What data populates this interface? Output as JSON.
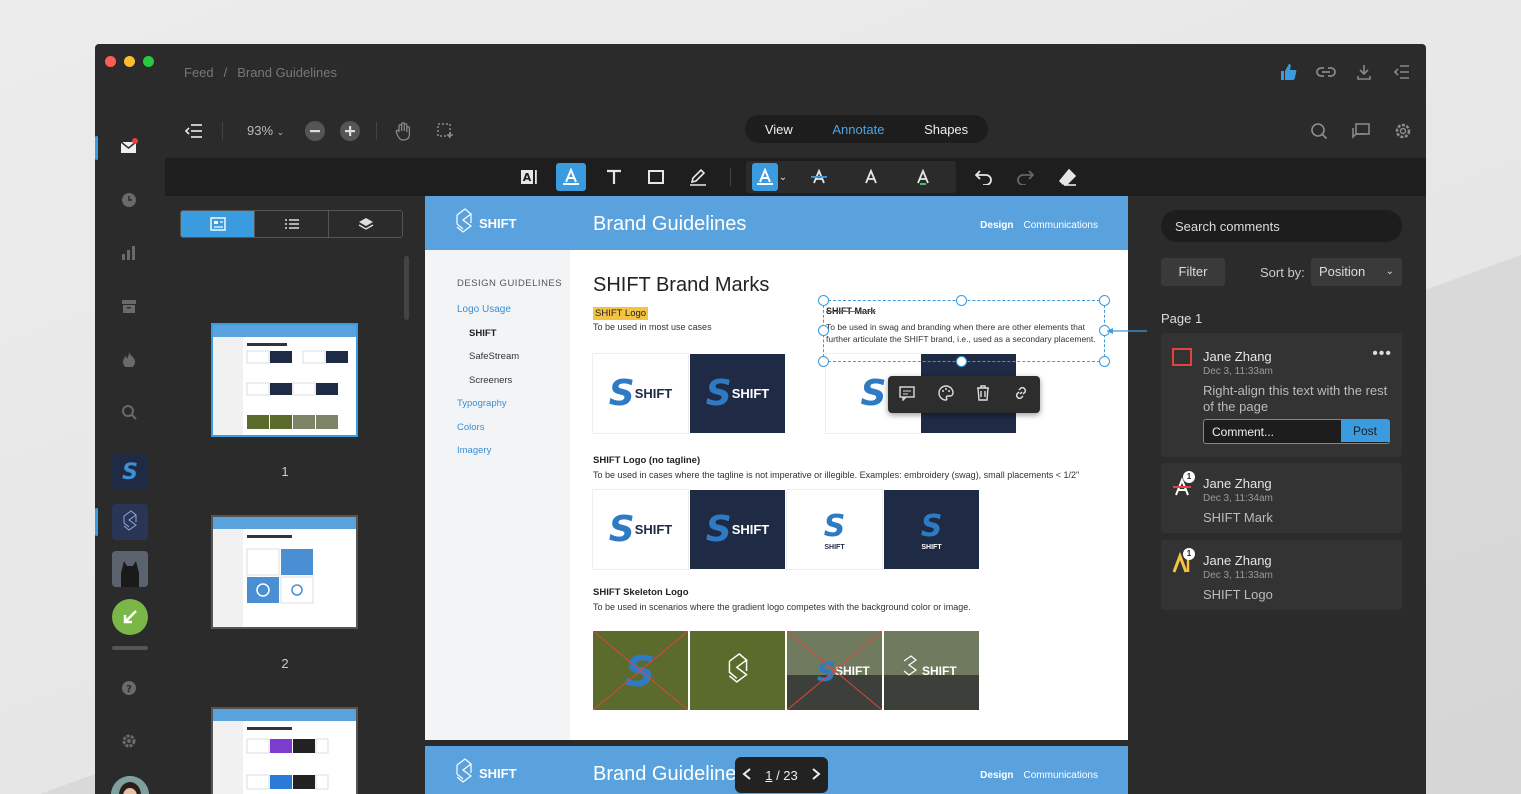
{
  "window": {
    "breadcrumb": [
      "Feed",
      "/",
      "Brand Guidelines"
    ]
  },
  "toolbar": {
    "zoom": "93%",
    "modes": [
      "View",
      "Annotate",
      "Shapes"
    ],
    "active_mode": "Annotate"
  },
  "thumbnails": {
    "pages": [
      "1",
      "2"
    ]
  },
  "document": {
    "header_logo": "SHIFT",
    "header_title": "Brand Guidelines",
    "nav_design": "Design",
    "nav_communications": "Communications",
    "sidebar_heading": "DESIGN GUIDELINES",
    "sidebar_items": [
      "Logo Usage",
      "SHIFT",
      "SafeStream",
      "Screeners",
      "Typography",
      "Colors",
      "Imagery"
    ],
    "section_title": "SHIFT Brand Marks",
    "shift_logo_heading": "SHIFT Logo",
    "shift_logo_desc": "To be used in most use cases",
    "shift_mark_heading": "SHIFT Mark",
    "shift_mark_desc": "To be used in swag and branding when there are other elements that further articulate the SHIFT brand, i.e., used as a secondary placement.",
    "no_tagline_heading": "SHIFT Logo (no tagline)",
    "no_tagline_desc": "To be used in cases where the tagline is not imperative or illegible. Examples: embroidery (swag), small placements < 1/2\"",
    "skeleton_heading": "SHIFT Skeleton Logo",
    "skeleton_desc": "To be used in scenarios where the gradient logo competes with the background color or image.",
    "logo_word": "SHIFT",
    "page2_title": "Brand Guideline"
  },
  "pager": {
    "current": "1",
    "total": "/ 23"
  },
  "comments": {
    "search_placeholder": "Search comments",
    "filter": "Filter",
    "sort_label": "Sort by:",
    "sort_value": "Position",
    "page_label": "Page 1",
    "items": [
      {
        "author": "Jane Zhang",
        "date": "Dec 3, 11:33am",
        "text": "Right-align this text with the rest of the page",
        "input_placeholder": "Comment...",
        "post": "Post"
      },
      {
        "author": "Jane Zhang",
        "date": "Dec 3, 11:34am",
        "text": "SHIFT Mark",
        "badge": "1"
      },
      {
        "author": "Jane Zhang",
        "date": "Dec 3, 11:33am",
        "text": "SHIFT Logo",
        "badge": "1"
      }
    ]
  },
  "colors": {
    "accent": "#3a9bdf",
    "header_blue": "#5aa2de",
    "highlight": "#f5c342",
    "strike_red": "#e0443c"
  }
}
